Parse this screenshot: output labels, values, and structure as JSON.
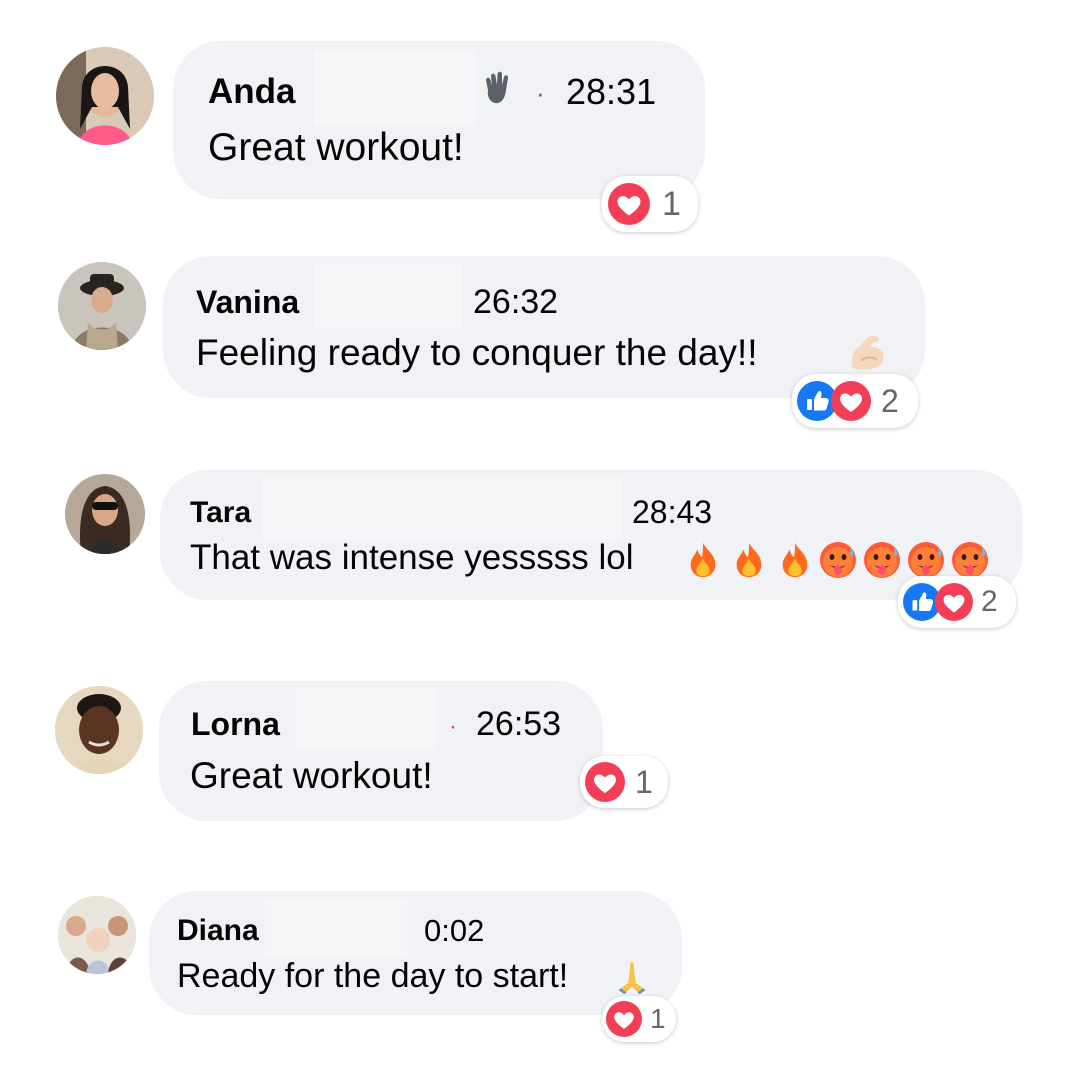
{
  "comments": [
    {
      "name": "Anda",
      "time": "28:31",
      "text": "Great workout!",
      "reaction_count": "1",
      "reactions": [
        "love-icon"
      ],
      "extra_icon": "waving-hand-icon"
    },
    {
      "name": "Vanina",
      "time": "26:32",
      "text": "Feeling ready to conquer the day!!",
      "reaction_count": "2",
      "reactions": [
        "like-icon",
        "love-icon"
      ],
      "emoji": [
        "flexed-biceps-icon"
      ]
    },
    {
      "name": "Tara",
      "time": "28:43",
      "text": "That was intense yesssss lol",
      "reaction_count": "2",
      "reactions": [
        "like-icon",
        "love-icon"
      ],
      "emoji": [
        "fire-icon",
        "fire-icon",
        "fire-icon",
        "hot-face-icon",
        "hot-face-icon",
        "hot-face-icon",
        "hot-face-icon"
      ]
    },
    {
      "name": "Lorna",
      "time": "26:53",
      "text": "Great workout!",
      "reaction_count": "1",
      "reactions": [
        "love-icon"
      ]
    },
    {
      "name": "Diana",
      "time": "0:02",
      "text": "Ready for the day to start!",
      "reaction_count": "1",
      "reactions": [
        "love-icon"
      ],
      "emoji": [
        "folded-hands-icon"
      ]
    }
  ],
  "colors": {
    "bubble": "#f0f2f5",
    "like": "#1877f2",
    "love": "#f33e58",
    "meta": "#65676b"
  }
}
